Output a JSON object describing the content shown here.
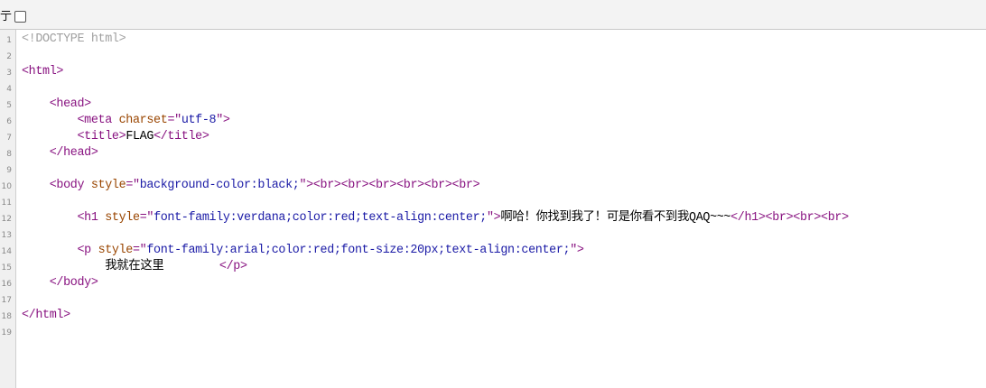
{
  "toolbar": {
    "wrap_label": "亍",
    "wrap_checked": false
  },
  "lines": [
    {
      "n": "1",
      "tokens": [
        {
          "t": "doctype",
          "s": "<!DOCTYPE html>"
        }
      ]
    },
    {
      "n": "2",
      "tokens": []
    },
    {
      "n": "3",
      "tokens": [
        {
          "t": "tag",
          "s": "<html>"
        }
      ]
    },
    {
      "n": "4",
      "tokens": []
    },
    {
      "n": "5",
      "tokens": [
        {
          "t": "txt",
          "s": "    "
        },
        {
          "t": "tag",
          "s": "<head>"
        }
      ]
    },
    {
      "n": "6",
      "tokens": [
        {
          "t": "txt",
          "s": "        "
        },
        {
          "t": "tag",
          "s": "<meta "
        },
        {
          "t": "attr",
          "s": "charset"
        },
        {
          "t": "tag",
          "s": "=\""
        },
        {
          "t": "val",
          "s": "utf-8"
        },
        {
          "t": "tag",
          "s": "\">"
        }
      ]
    },
    {
      "n": "7",
      "tokens": [
        {
          "t": "txt",
          "s": "        "
        },
        {
          "t": "tag",
          "s": "<title>"
        },
        {
          "t": "txt",
          "s": "FLAG"
        },
        {
          "t": "tag",
          "s": "</title>"
        }
      ]
    },
    {
      "n": "8",
      "tokens": [
        {
          "t": "txt",
          "s": "    "
        },
        {
          "t": "tag",
          "s": "</head>"
        }
      ]
    },
    {
      "n": "9",
      "tokens": []
    },
    {
      "n": "10",
      "tokens": [
        {
          "t": "txt",
          "s": "    "
        },
        {
          "t": "tag",
          "s": "<body "
        },
        {
          "t": "attr",
          "s": "style"
        },
        {
          "t": "tag",
          "s": "=\""
        },
        {
          "t": "val",
          "s": "background-color:black;"
        },
        {
          "t": "tag",
          "s": "\"><br><br><br><br><br><br>"
        }
      ]
    },
    {
      "n": "11",
      "tokens": []
    },
    {
      "n": "12",
      "tokens": [
        {
          "t": "txt",
          "s": "        "
        },
        {
          "t": "tag",
          "s": "<h1 "
        },
        {
          "t": "attr",
          "s": "style"
        },
        {
          "t": "tag",
          "s": "=\""
        },
        {
          "t": "val",
          "s": "font-family:verdana;color:red;text-align:center;"
        },
        {
          "t": "tag",
          "s": "\">"
        },
        {
          "t": "txt",
          "s": "啊哈！你找到我了！可是你看不到我QAQ~~~"
        },
        {
          "t": "tag",
          "s": "</h1><br><br><br>"
        }
      ]
    },
    {
      "n": "13",
      "tokens": []
    },
    {
      "n": "14",
      "tokens": [
        {
          "t": "txt",
          "s": "        "
        },
        {
          "t": "tag",
          "s": "<p "
        },
        {
          "t": "attr",
          "s": "style"
        },
        {
          "t": "tag",
          "s": "=\""
        },
        {
          "t": "val",
          "s": "font-family:arial;color:red;font-size:20px;text-align:center;"
        },
        {
          "t": "tag",
          "s": "\">"
        }
      ]
    },
    {
      "n": "15",
      "tokens": [
        {
          "t": "txt",
          "s": "            我就在这里        "
        },
        {
          "t": "tag",
          "s": "</p>"
        }
      ]
    },
    {
      "n": "16",
      "tokens": [
        {
          "t": "txt",
          "s": "    "
        },
        {
          "t": "tag",
          "s": "</body>"
        }
      ]
    },
    {
      "n": "17",
      "tokens": []
    },
    {
      "n": "18",
      "tokens": [
        {
          "t": "tag",
          "s": "</html>"
        }
      ]
    },
    {
      "n": "19",
      "tokens": []
    }
  ]
}
